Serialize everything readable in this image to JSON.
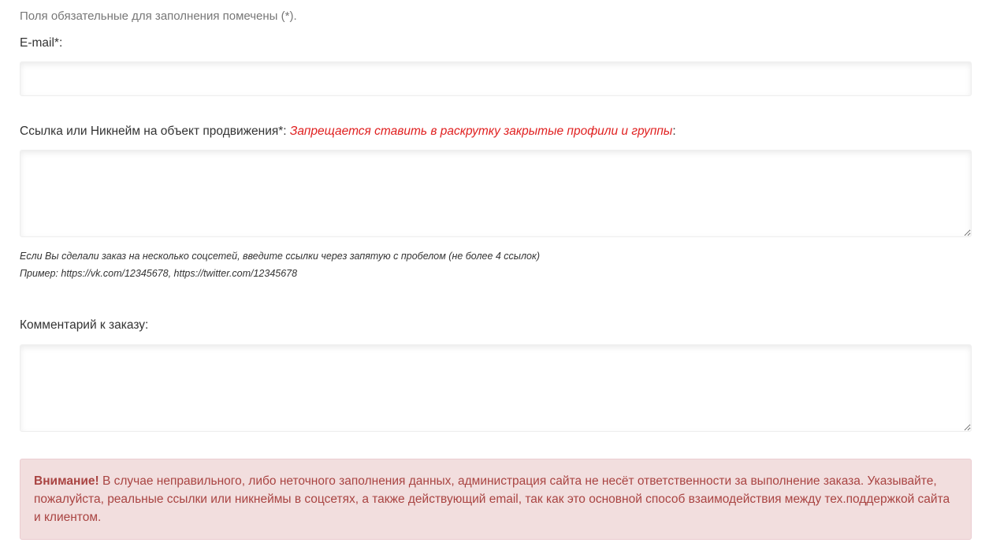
{
  "form": {
    "required_note": "Поля обязательные для заполнения помечены (*).",
    "email": {
      "label": "E-mail*:",
      "value": "",
      "placeholder": ""
    },
    "link": {
      "label": "Ссылка или Никнейм на объект продвижения*: ",
      "warning": "Запрещается ставить в раскрутку закрытые профили и группы",
      "label_suffix": ":",
      "value": "",
      "placeholder": "",
      "hint_line_1": "Если Вы сделали заказ на несколько соцсетей, введите ссылки через запятую с пробелом (не более 4 ссылок)",
      "hint_line_2": "Пример: https://vk.com/12345678, https://twitter.com/12345678"
    },
    "comment": {
      "label": "Комментарий к заказу:",
      "value": "",
      "placeholder": ""
    }
  },
  "alert": {
    "title": "Внимание!",
    "text": " В случае неправильного, либо неточного заполнения данных, администрация сайта не несёт ответственности за выполнение заказа. Указывайте, пожалуйста, реальные ссылки или никнеймы в соцсетях, а также действующий email, так как это основной способ взаимодействия между тех.поддержкой сайта и клиентом.",
    "background_color": "#f2dede",
    "text_color": "#a94442"
  },
  "colors": {
    "inline_warning": "#e02020"
  }
}
